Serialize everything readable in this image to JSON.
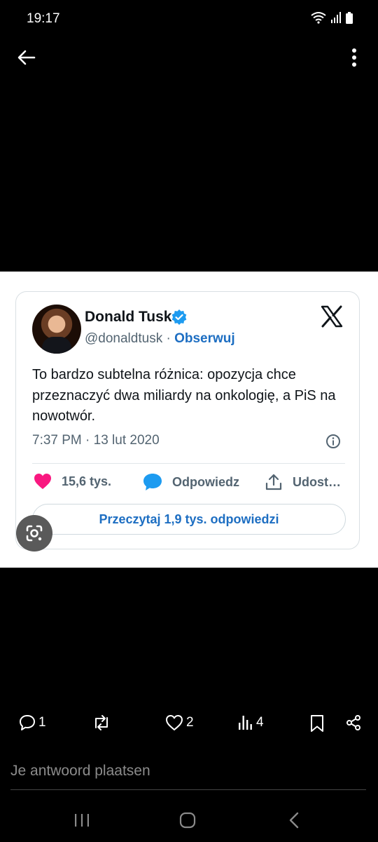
{
  "status_bar": {
    "time": "19:17"
  },
  "tweet": {
    "name": "Donald Tusk",
    "handle": "@donaldtusk",
    "separator": "·",
    "follow_label": "Obserwuj",
    "text": "To bardzo subtelna różnica: opozycja chce przeznaczyć dwa miliardy na onkologię, a PiS na nowotwór.",
    "timestamp": "7:37 PM · 13 lut 2020",
    "likes": "15,6 tys.",
    "reply_label": "Odpowiedz",
    "share_label": "Udost…",
    "read_replies_label": "Przeczytaj 1,9 tys. odpowiedzi"
  },
  "post_actions": {
    "replies": "1",
    "likes": "2",
    "views": "4"
  },
  "reply_input": {
    "placeholder": "Je antwoord plaatsen"
  },
  "colors": {
    "link_blue": "#1d6ec2",
    "like_pink": "#f91880",
    "verified_blue": "#1d9bf0"
  }
}
